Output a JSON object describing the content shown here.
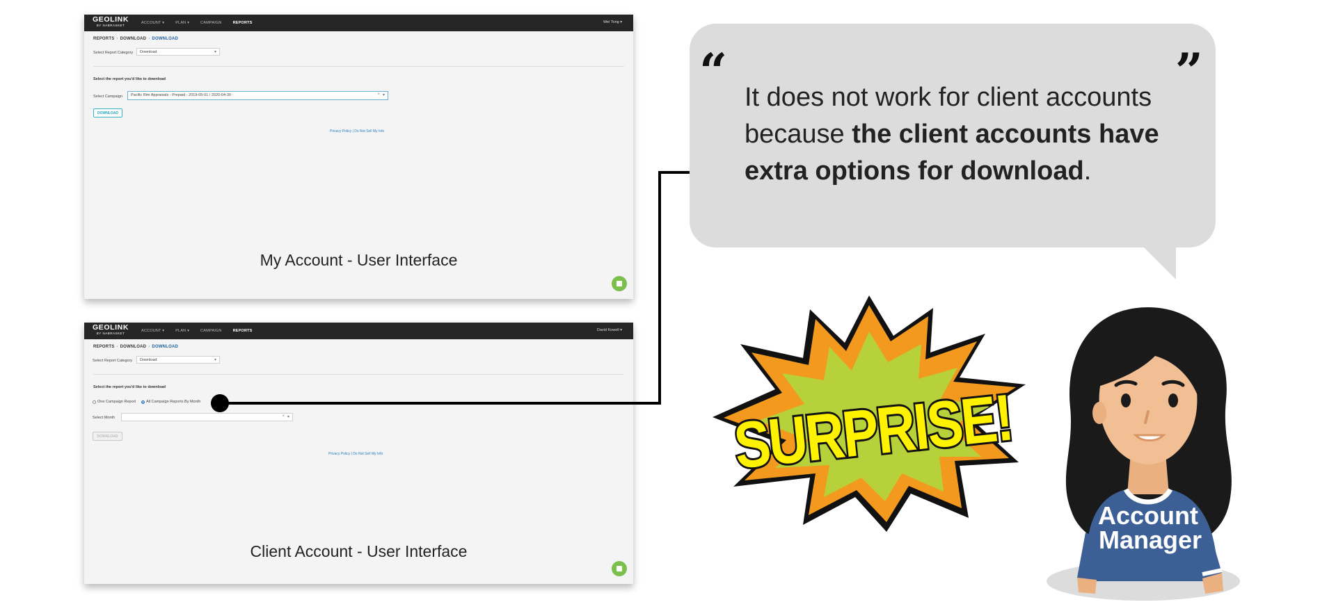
{
  "my_account": {
    "logo": {
      "name": "GEOLINK",
      "sub": "BY NABRASKET"
    },
    "nav": [
      {
        "label": "ACCOUNT ▾",
        "active": false
      },
      {
        "label": "PLAN ▾",
        "active": false
      },
      {
        "label": "CAMPAIGN",
        "active": false
      },
      {
        "label": "REPORTS",
        "active": true
      }
    ],
    "user": "Wei Tong ▾",
    "breadcrumb": [
      "REPORTS",
      "DOWNLOAD",
      "DOWNLOAD"
    ],
    "breadcrumb_sep": "›",
    "report_category_label": "Select Report Category",
    "report_category_value": "Download",
    "section_heading": "Select the report you'd like to download",
    "campaign_label": "Select Campaign",
    "campaign_value": "Pacific Rim Appraisals - Prepaid - 2019-05-01 / 2020-04-30",
    "download_button": "DOWNLOAD",
    "footer": "Privacy Policy | Do Not Sell My Info",
    "caption": "My Account - User Interface"
  },
  "client_account": {
    "logo": {
      "name": "GEOLINK",
      "sub": "BY NABRASKET"
    },
    "nav": [
      {
        "label": "ACCOUNT ▾",
        "active": false
      },
      {
        "label": "PLAN ▾",
        "active": false
      },
      {
        "label": "CAMPAIGN",
        "active": false
      },
      {
        "label": "REPORTS",
        "active": true
      }
    ],
    "user": "David Kowell ▾",
    "breadcrumb": [
      "REPORTS",
      "DOWNLOAD",
      "DOWNLOAD"
    ],
    "breadcrumb_sep": "›",
    "report_category_label": "Select Report Category",
    "report_category_value": "Download",
    "section_heading": "Select the report you'd like to download",
    "radio_options": [
      {
        "label": "One Campaign Report",
        "selected": false
      },
      {
        "label": "All Campaign Reports By Month",
        "selected": true
      }
    ],
    "month_label": "Select Month",
    "month_value": "",
    "download_button": "DOWNLOAD",
    "footer": "Privacy Policy | Do Not Sell My Info",
    "caption": "Client Account - User Interface"
  },
  "bubble": {
    "open_quote": "“",
    "close_quote": "”",
    "text_plain": "It does not work for client accounts because ",
    "text_bold": "the client accounts have extra options for download",
    "text_end": "."
  },
  "surprise_text": "SURPRISE!",
  "manager_label": [
    "Account",
    "Manager"
  ],
  "colors": {
    "navbar": "#262626",
    "link_blue": "#1f5f9f",
    "button_teal": "#37b3c7",
    "chat_green": "#7bbf4c",
    "bubble_gray": "#dcdcdc",
    "burst_orange": "#f39a1e",
    "burst_green": "#b7d13b",
    "text_yellow": "#fff200",
    "shirt_blue": "#3c5f96"
  }
}
